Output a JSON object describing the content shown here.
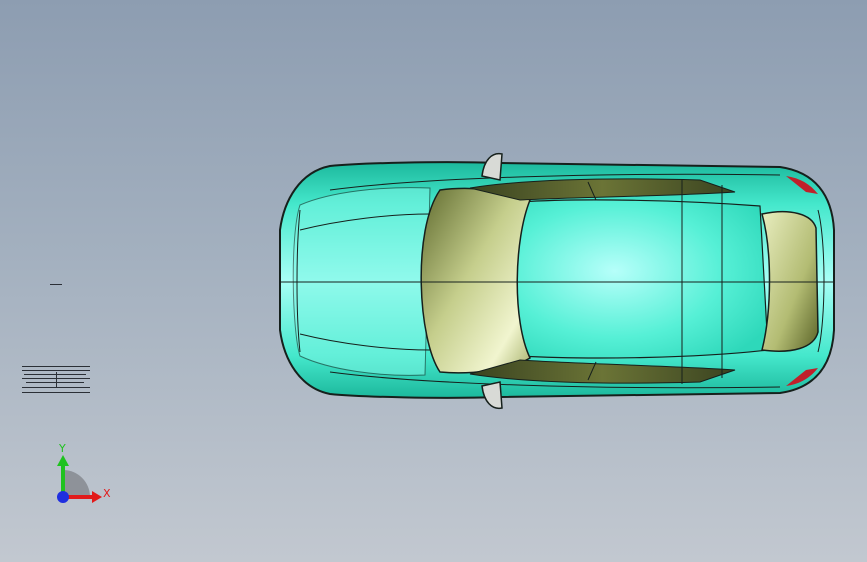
{
  "triad": {
    "y_label": "Y",
    "x_label": "X",
    "colors": {
      "x": "#e21a1a",
      "y": "#1fc21f",
      "z": "#1f2fe0"
    }
  },
  "model": {
    "body_color": "#3de6c9",
    "glass_color": "#c9d48a",
    "outline_color": "#1a1f1c"
  }
}
